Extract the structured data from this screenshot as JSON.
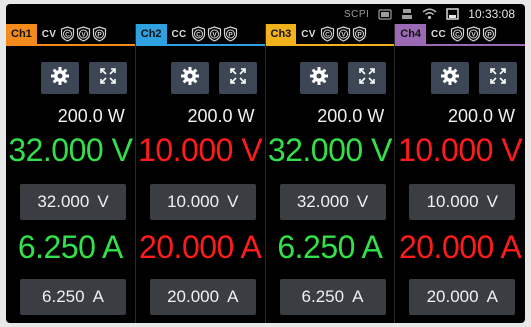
{
  "status": {
    "scpi": "SCPI",
    "time": "10:33:08"
  },
  "colors": {
    "green": "#33e04a",
    "red": "#ff1b1b"
  },
  "channels": [
    {
      "label": "Ch1",
      "color": "#f28a1c",
      "mode": "CV",
      "protections": [
        "C",
        "V",
        "P"
      ],
      "power": "200.0 W",
      "voltage": "32.000 V",
      "voltage_color": "green",
      "set_voltage": "32.000",
      "set_voltage_unit": "V",
      "current": "6.250 A",
      "current_color": "green",
      "set_current": "6.250",
      "set_current_unit": "A"
    },
    {
      "label": "Ch2",
      "color": "#2fa0e0",
      "mode": "CC",
      "protections": [
        "C",
        "V",
        "P"
      ],
      "power": "200.0 W",
      "voltage": "10.000 V",
      "voltage_color": "red",
      "set_voltage": "10.000",
      "set_voltage_unit": "V",
      "current": "20.000 A",
      "current_color": "red",
      "set_current": "20.000",
      "set_current_unit": "A"
    },
    {
      "label": "Ch3",
      "color": "#f2b21c",
      "mode": "CV",
      "protections": [
        "C",
        "V",
        "P"
      ],
      "power": "200.0 W",
      "voltage": "32.000 V",
      "voltage_color": "green",
      "set_voltage": "32.000",
      "set_voltage_unit": "V",
      "current": "6.250 A",
      "current_color": "green",
      "set_current": "6.250",
      "set_current_unit": "A"
    },
    {
      "label": "Ch4",
      "color": "#9a6bb4",
      "mode": "CC",
      "protections": [
        "C",
        "V",
        "P"
      ],
      "power": "200.0 W",
      "voltage": "10.000 V",
      "voltage_color": "red",
      "set_voltage": "10.000",
      "set_voltage_unit": "V",
      "current": "20.000 A",
      "current_color": "red",
      "set_current": "20.000",
      "set_current_unit": "A"
    }
  ]
}
